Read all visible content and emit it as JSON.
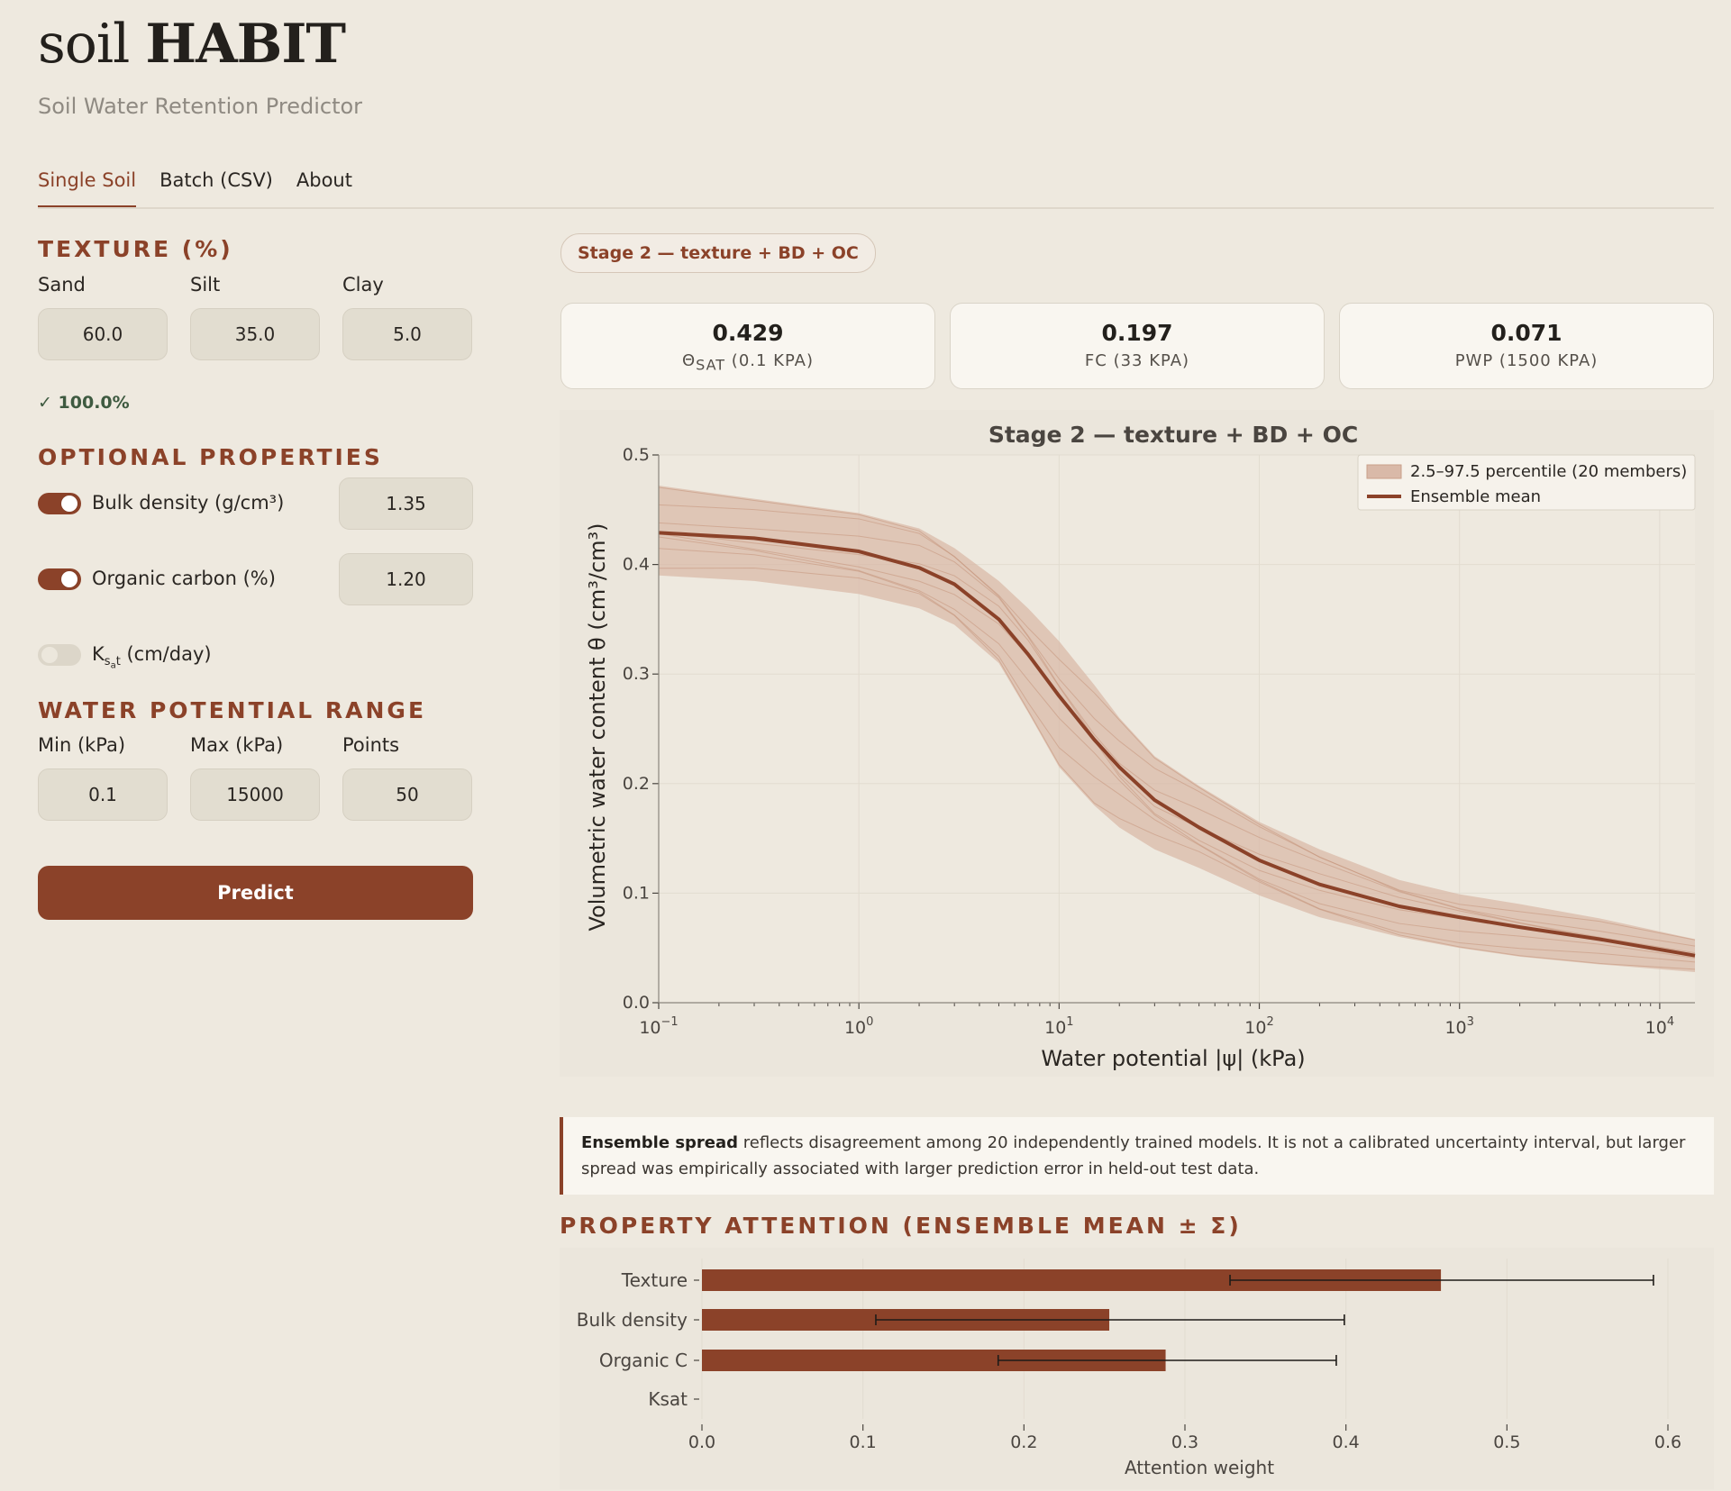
{
  "app": {
    "brand_light": "soil",
    "brand_bold": "HABIT",
    "subtitle": "Soil Water Retention Predictor"
  },
  "tabs": [
    {
      "label": "Single Soil",
      "active": true
    },
    {
      "label": "Batch (CSV)"
    },
    {
      "label": "About"
    }
  ],
  "sidebar": {
    "texture": {
      "heading": "TEXTURE (%)",
      "sand_label": "Sand",
      "silt_label": "Silt",
      "clay_label": "Clay",
      "sand": "60.0",
      "silt": "35.0",
      "clay": "5.0",
      "sum_check": "✓ 100.0%"
    },
    "optional": {
      "heading": "OPTIONAL PROPERTIES",
      "bulk_density": {
        "label": "Bulk density (g/cm³)",
        "enabled": true,
        "value": "1.35"
      },
      "organic_carbon": {
        "label": "Organic carbon (%)",
        "enabled": true,
        "value": "1.20"
      },
      "ksat": {
        "label": "K",
        "sub1": "s",
        "sub2": "a",
        "sub3": "t",
        "unit": " (cm/day)",
        "enabled": false
      }
    },
    "range": {
      "heading": "WATER POTENTIAL RANGE",
      "min_label": "Min (kPa)",
      "max_label": "Max (kPa)",
      "points_label": "Points",
      "min": "0.1",
      "max": "15000",
      "points": "50"
    },
    "predict_label": "Predict"
  },
  "results": {
    "stage_badge": "Stage 2 — texture + BD + OC",
    "cards": [
      {
        "value": "0.429",
        "key_pre": "Θ",
        "key_sub": "SAT",
        "key_post": " (0.1 KPA)"
      },
      {
        "value": "0.197",
        "key": "FC (33 KPA)"
      },
      {
        "value": "0.071",
        "key": "PWP (1500 KPA)"
      }
    ],
    "note_bold": "Ensemble spread",
    "note_line1": " reflects disagreement among 20 independently trained models. It is not a calibrated uncertainty interval, but larger",
    "note_line2": "spread was empirically associated with larger prediction error in held-out test data.",
    "attention_heading": "PROPERTY ATTENTION (ENSEMBLE MEAN ± Σ)"
  },
  "colors": {
    "accent": "#8B4229",
    "band": "#D9B9A8",
    "background": "#EEE9DF"
  },
  "chart_data": [
    {
      "type": "line",
      "title": "Stage 2 — texture + BD + OC",
      "xlabel": "Water potential |ψ| (kPa)",
      "ylabel": "Volumetric water content θ (cm³/cm³)",
      "xscale": "log",
      "xlim": [
        0.1,
        15000
      ],
      "ylim": [
        0,
        0.5
      ],
      "xtick_labels": [
        "10",
        "10",
        "10",
        "10",
        "10",
        "10"
      ],
      "xtick_exponents": [
        "−1",
        "0",
        "1",
        "2",
        "3",
        "4"
      ],
      "ytick_labels": [
        "0.0",
        "0.1",
        "0.2",
        "0.3",
        "0.4",
        "0.5"
      ],
      "legend_position": "top-right",
      "grid": true,
      "legend": {
        "band": "2.5–97.5 percentile (20 members)",
        "mean": "Ensemble mean"
      },
      "x": [
        0.1,
        0.3,
        1,
        2,
        3,
        5,
        7,
        10,
        15,
        20,
        30,
        50,
        100,
        200,
        500,
        1000,
        2000,
        5000,
        15000
      ],
      "mean": [
        0.429,
        0.424,
        0.412,
        0.397,
        0.382,
        0.35,
        0.318,
        0.28,
        0.24,
        0.215,
        0.185,
        0.16,
        0.13,
        0.108,
        0.088,
        0.078,
        0.069,
        0.058,
        0.043
      ],
      "upper": [
        0.472,
        0.46,
        0.447,
        0.433,
        0.415,
        0.385,
        0.36,
        0.33,
        0.29,
        0.26,
        0.225,
        0.198,
        0.165,
        0.14,
        0.112,
        0.099,
        0.09,
        0.077,
        0.058
      ],
      "lower": [
        0.39,
        0.385,
        0.373,
        0.36,
        0.345,
        0.31,
        0.265,
        0.215,
        0.18,
        0.16,
        0.14,
        0.123,
        0.098,
        0.078,
        0.06,
        0.05,
        0.042,
        0.035,
        0.028
      ]
    },
    {
      "type": "bar",
      "orientation": "horizontal",
      "categories": [
        "Texture",
        "Bulk density",
        "Organic C",
        "Ksat"
      ],
      "values": [
        0.459,
        0.253,
        0.288,
        0.0
      ],
      "error_low": [
        0.328,
        0.108,
        0.184,
        0.0
      ],
      "error_high": [
        0.591,
        0.399,
        0.394,
        0.0
      ],
      "xlabel": "Attention weight",
      "xlim": [
        0,
        0.6
      ],
      "xtick_labels": [
        "0.0",
        "0.1",
        "0.2",
        "0.3",
        "0.4",
        "0.5",
        "0.6"
      ]
    }
  ]
}
